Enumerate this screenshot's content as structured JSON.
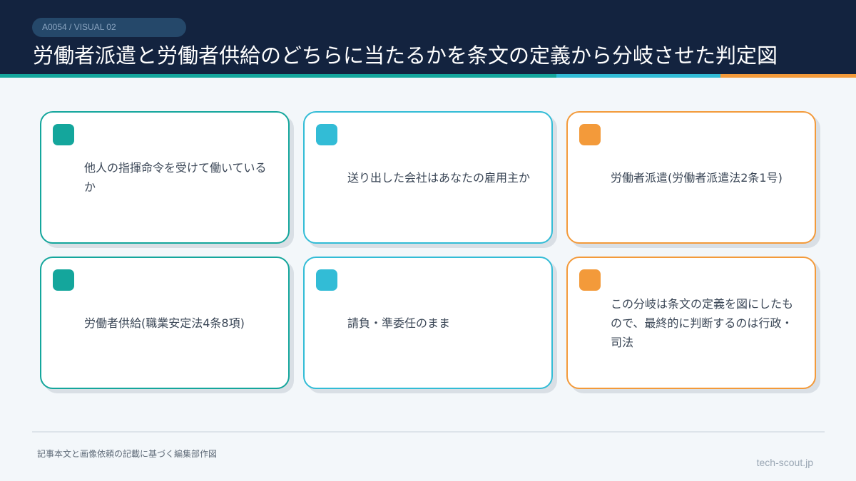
{
  "header": {
    "tag": "A0054 / VISUAL 02",
    "title": "労働者派遣と労働者供給のどちらに当たるかを条文の定義から分岐させた判定図"
  },
  "cards": [
    {
      "text": "他人の指揮命令を受けて働いているか",
      "color": "#14a69c"
    },
    {
      "text": "送り出した会社はあなたの雇用主か",
      "color": "#32bcd6"
    },
    {
      "text": "労働者派遣(労働者派遣法2条1号)",
      "color": "#f39a3a"
    },
    {
      "text": "労働者供給(職業安定法4条8項)",
      "color": "#14a69c"
    },
    {
      "text": "請負・準委任のまま",
      "color": "#32bcd6"
    },
    {
      "text": "この分岐は条文の定義を図にしたもので、最終的に判断するのは行政・司法",
      "color": "#f39a3a"
    }
  ],
  "footer": {
    "note": "記事本文と画像依頼の記載に基づく編集部作図",
    "site": "tech-scout.jp"
  },
  "colors": {
    "header_bg": "#13233f",
    "teal": "#14a69c",
    "cyan": "#32bcd6",
    "orange": "#f39a3a"
  }
}
